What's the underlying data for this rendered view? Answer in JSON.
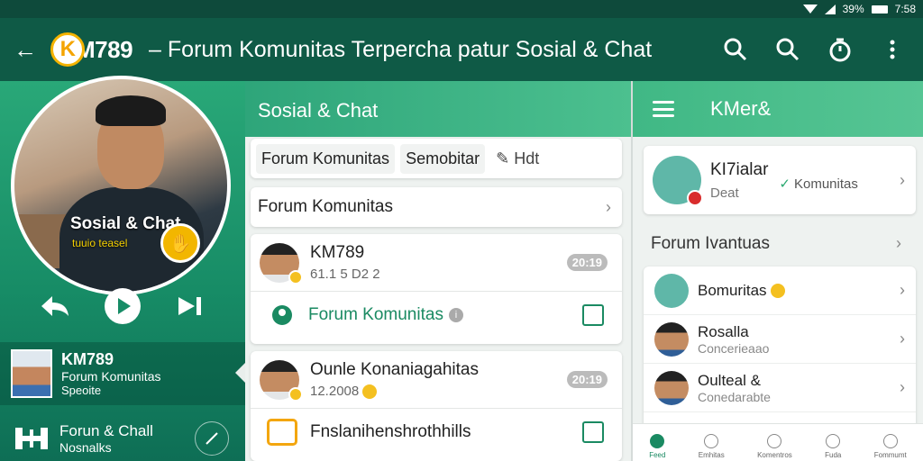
{
  "status": {
    "battery": "39%",
    "time": "7:58"
  },
  "appbar": {
    "logo_k": "K",
    "logo_rest": "M789",
    "title": "– Forum Komunitas Terpercha patur Sosial & Chat"
  },
  "left": {
    "hero_caption": "Sosial & Chat",
    "hero_sub": "tuuio teasel",
    "profile_name": "KM789",
    "profile_line1": "Forum Komunitas",
    "profile_line2": "Speoite",
    "footer_title": "Forun & Chall",
    "footer_sub": "Nosnalks"
  },
  "middle": {
    "header": "Sosial & Chat",
    "tabs": [
      "Forum Komunitas",
      "Semobitar",
      "Hdt"
    ],
    "section": "Forum Komunitas",
    "item1": {
      "name": "KM789",
      "meta": "61.1 5 D2 2",
      "pill": "20:19"
    },
    "sub1": "Forum Komunitas",
    "item2": {
      "name": "Ounle Konaniagahitas",
      "meta": "12.2008",
      "pill": "20:19"
    },
    "sub2": "Fnslanihenshrothhills"
  },
  "right": {
    "header": "KMer&",
    "card": {
      "title": "KI7ialar",
      "sub": "Deat",
      "tag": "Komunitas"
    },
    "section": "Forum Ivantuas",
    "items": [
      {
        "name": "Bomuritas",
        "sub": ""
      },
      {
        "name": "Rosalla",
        "sub": "Concerieaao"
      },
      {
        "name": "Oulteal &",
        "sub": "Conedarabte"
      }
    ],
    "nav": [
      "Feed",
      "Emhitas",
      "Komentros",
      "Fuda",
      "Fommumt"
    ]
  }
}
